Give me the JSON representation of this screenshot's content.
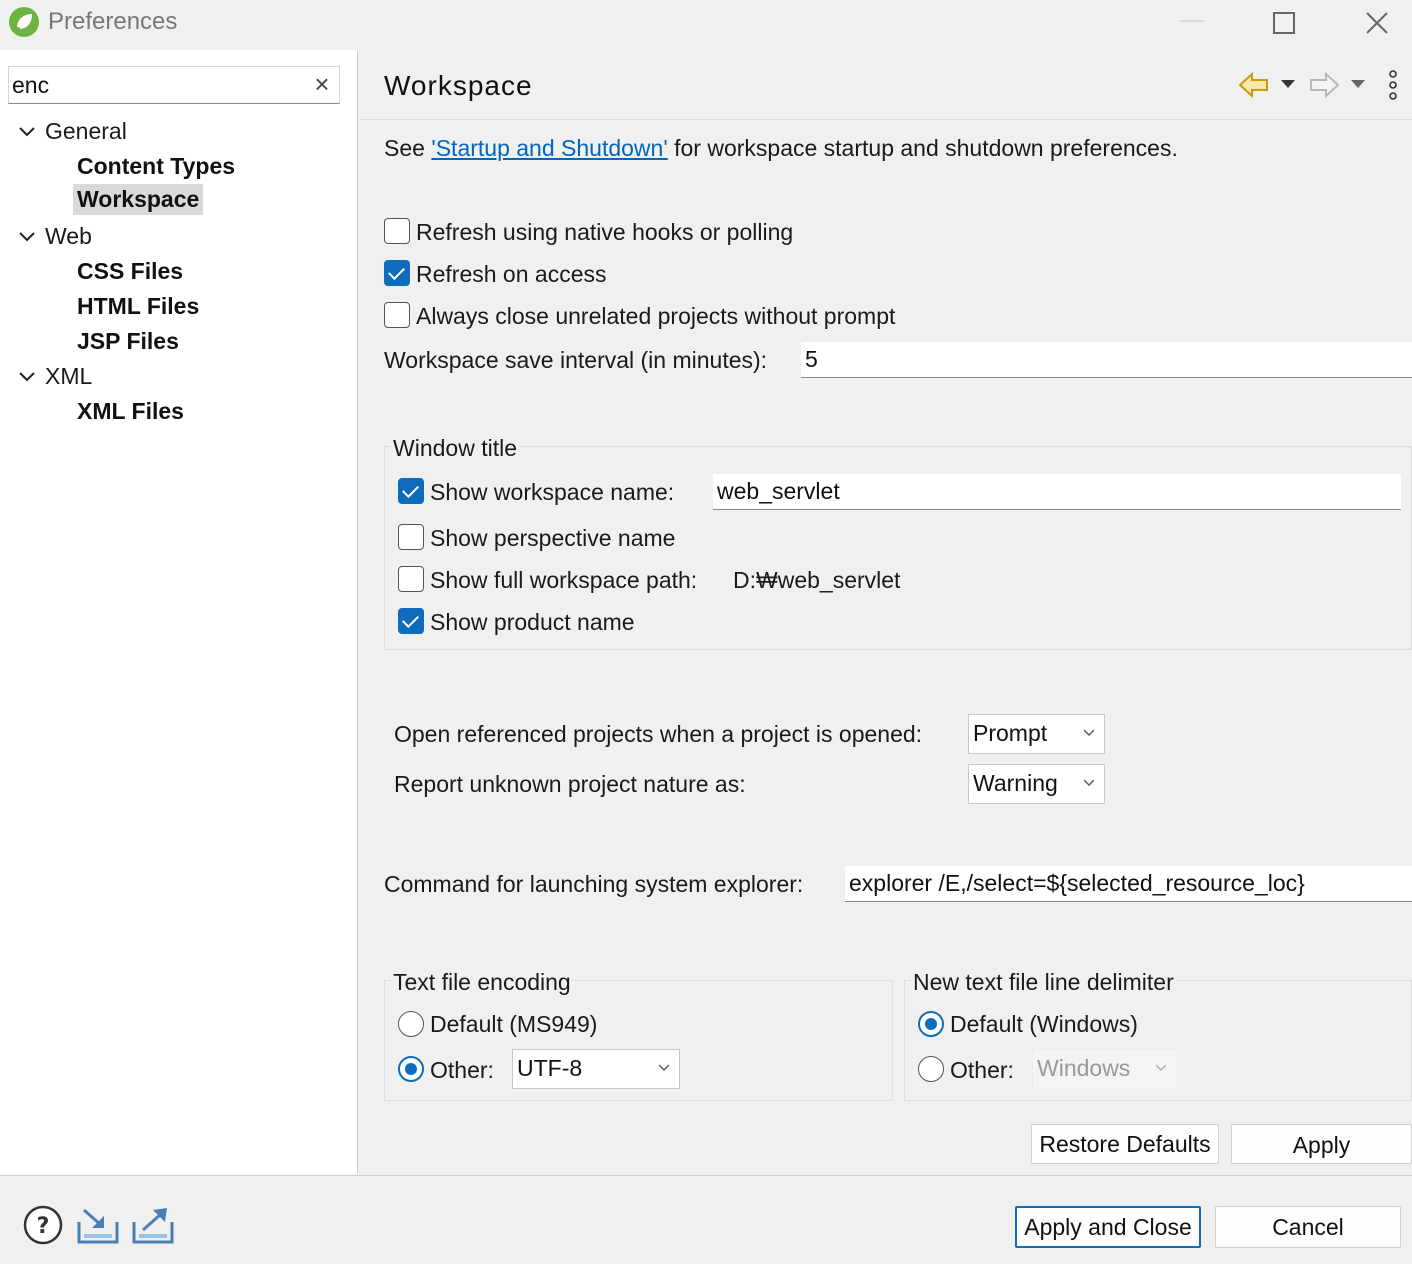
{
  "window": {
    "title": "Preferences"
  },
  "filter": {
    "value": "enc",
    "clear_icon": "×"
  },
  "tree": {
    "groups": [
      {
        "label": "General",
        "children": [
          "Content Types",
          "Workspace"
        ]
      },
      {
        "label": "Web",
        "children": [
          "CSS Files",
          "HTML Files",
          "JSP Files"
        ]
      },
      {
        "label": "XML",
        "children": [
          "XML Files"
        ]
      }
    ],
    "selected": "Workspace"
  },
  "page": {
    "title": "Workspace",
    "intro_prefix": "See",
    "intro_link": "'Startup and Shutdown'",
    "intro_suffix": "for workspace startup and shutdown preferences.",
    "refresh_native": {
      "label": "Refresh using native hooks or polling",
      "checked": false
    },
    "refresh_access": {
      "label": "Refresh on access",
      "checked": true
    },
    "always_close": {
      "label": "Always close unrelated projects without prompt",
      "checked": false
    },
    "save_interval": {
      "label": "Workspace save interval (in minutes):",
      "value": "5"
    },
    "window_title": {
      "group_label": "Window title",
      "show_workspace_name": {
        "label": "Show workspace name:",
        "checked": true,
        "value": "web_servlet"
      },
      "show_perspective_name": {
        "label": "Show perspective name",
        "checked": false
      },
      "show_full_path": {
        "label": "Show full workspace path:",
        "checked": false,
        "value": "D:₩web_servlet"
      },
      "show_product_name": {
        "label": "Show product name",
        "checked": true
      }
    },
    "open_referenced": {
      "label": "Open referenced projects when a project is opened:",
      "value": "Prompt"
    },
    "report_unknown": {
      "label": "Report unknown project nature as:",
      "value": "Warning"
    },
    "explorer_command": {
      "label": "Command for launching system explorer:",
      "value": "explorer /E,/select=${selected_resource_loc}"
    },
    "encoding": {
      "group_label": "Text file encoding",
      "default_label": "Default (MS949)",
      "other_label": "Other:",
      "selected": "other",
      "other_value": "UTF-8"
    },
    "line_delimiter": {
      "group_label": "New text file line delimiter",
      "default_label": "Default (Windows)",
      "other_label": "Other:",
      "selected": "default",
      "other_value": "Windows"
    },
    "restore_defaults": "Restore Defaults",
    "apply": "Apply"
  },
  "footer": {
    "apply_and_close": "Apply and Close",
    "cancel": "Cancel"
  },
  "colors": {
    "accent": "#0f6cbd",
    "link": "#0066bb",
    "nav_arrow": "#d4a017"
  }
}
